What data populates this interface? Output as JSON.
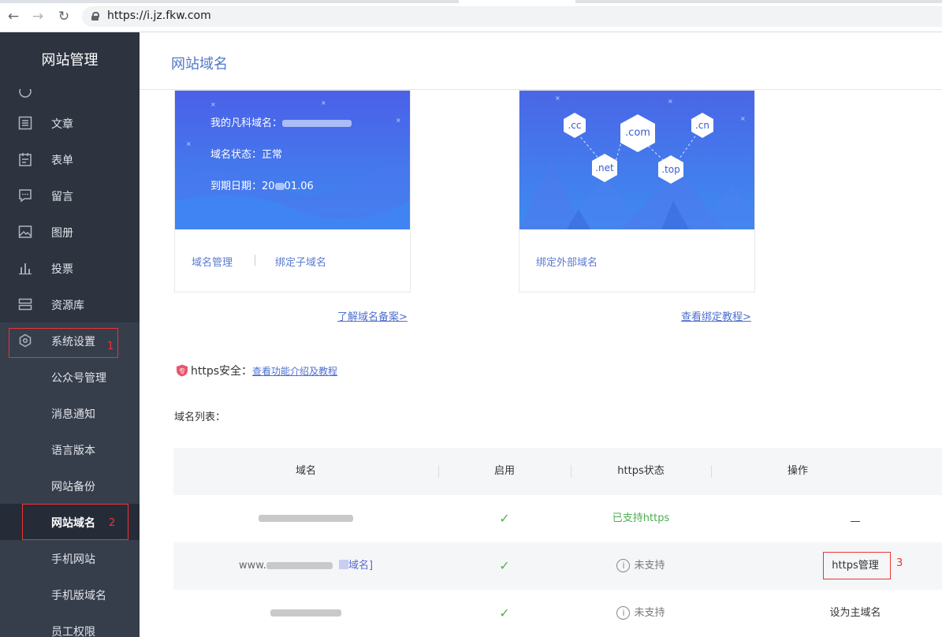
{
  "browser": {
    "url": "https://i.jz.fkw.com"
  },
  "sidebar": {
    "title": "网站管理",
    "items": [
      {
        "label": "文章"
      },
      {
        "label": "表单"
      },
      {
        "label": "留言"
      },
      {
        "label": "图册"
      },
      {
        "label": "投票"
      },
      {
        "label": "资源库"
      }
    ],
    "system": {
      "label": "系统设置",
      "marker": "1"
    },
    "subitems": [
      {
        "label": "公众号管理"
      },
      {
        "label": "消息通知"
      },
      {
        "label": "语言版本"
      },
      {
        "label": "网站备份"
      },
      {
        "label": "网站域名"
      },
      {
        "label": "手机网站"
      },
      {
        "label": "手机版域名"
      },
      {
        "label": "员工权限"
      }
    ],
    "active_marker": "2"
  },
  "header": {
    "title": "网站域名"
  },
  "card1": {
    "domain_label": "我的凡科域名：",
    "status_label": "域名状态：正常",
    "expiry_prefix": "到期日期：20",
    "expiry_suffix": "01.06",
    "link_manage": "域名管理",
    "link_bind_sub": "绑定子域名",
    "bottom_link": "了解域名备案>"
  },
  "card2": {
    "tags": [
      ".cc",
      ".com",
      ".cn",
      ".net",
      ".top"
    ],
    "link_bind_ext": "绑定外部域名",
    "bottom_link": "查看绑定教程>"
  },
  "https": {
    "label": "https安全：",
    "link": "查看功能介绍及教程"
  },
  "list": {
    "label": "域名列表：",
    "headers": [
      "域名",
      "启用",
      "https状态",
      "操作"
    ],
    "rows": [
      {
        "enabled": "✓",
        "https_status": "已支持https",
        "action": "—"
      },
      {
        "domain_prefix": "www.",
        "domain_suffix": "域名]",
        "enabled": "✓",
        "https_status": "未支持",
        "action": "https管理",
        "marker": "3"
      },
      {
        "enabled": "✓",
        "https_status": "未支持",
        "action": "设为主域名"
      }
    ]
  },
  "colors": {
    "sidebar_bg": "#2d3440",
    "accent": "#5078c8",
    "annotation": "#ee3333",
    "ok": "#4caf50"
  }
}
